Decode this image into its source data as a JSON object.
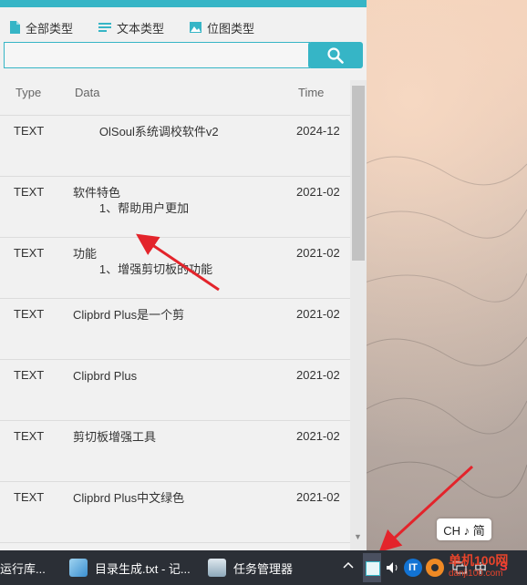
{
  "tabs": [
    {
      "label": "全部类型",
      "icon": "file-icon"
    },
    {
      "label": "文本类型",
      "icon": "text-lines-icon"
    },
    {
      "label": "位图类型",
      "icon": "image-icon"
    }
  ],
  "search": {
    "value": "",
    "placeholder": ""
  },
  "table": {
    "headers": {
      "type": "Type",
      "data": "Data",
      "time": "Time"
    },
    "rows": [
      {
        "type": "TEXT",
        "data": "        OlSoul系统调校软件v2",
        "time": "2024-12"
      },
      {
        "type": "TEXT",
        "data": "软件特色\n        1、帮助用户更加",
        "time": "2021-02"
      },
      {
        "type": "TEXT",
        "data": "功能\n        1、增强剪切板的功能",
        "time": "2021-02"
      },
      {
        "type": "TEXT",
        "data": "Clipbrd Plus是一个剪",
        "time": "2021-02"
      },
      {
        "type": "TEXT",
        "data": "Clipbrd Plus",
        "time": "2021-02"
      },
      {
        "type": "TEXT",
        "data": "剪切板增强工具",
        "time": "2021-02"
      },
      {
        "type": "TEXT",
        "data": "Clipbrd Plus中文绿色",
        "time": "2021-02"
      }
    ]
  },
  "ime": {
    "label": "CH ♪ 简"
  },
  "taskbar": {
    "items": [
      {
        "label": "运行库..."
      },
      {
        "label": "目录生成.txt - 记..."
      },
      {
        "label": "任务管理器"
      }
    ],
    "tray_ime": "中",
    "tray_it": "IT"
  },
  "watermark": {
    "logo": "单机100网",
    "url": "danji100.com"
  },
  "colors": {
    "accent": "#36b5c6",
    "annotation": "#e3242b",
    "taskbar": "#2b2f36"
  }
}
